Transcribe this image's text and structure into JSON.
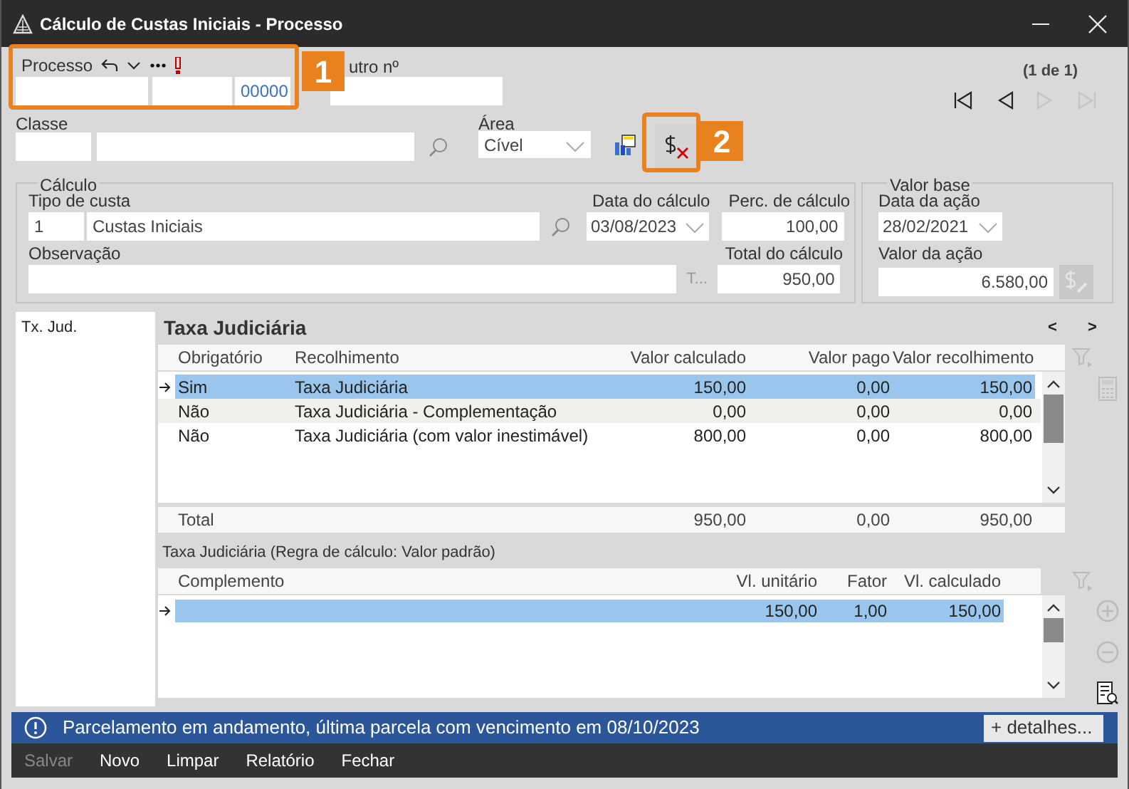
{
  "window": {
    "title": "Cálculo de Custas Iniciais - Processo"
  },
  "processo": {
    "label": "Processo",
    "suffix": "00000"
  },
  "outro_numero": {
    "label": "utro nº"
  },
  "pager": {
    "text": "(1 de 1)",
    "buttons": [
      {
        "disabled": false
      },
      {
        "disabled": false
      },
      {
        "disabled": true
      },
      {
        "disabled": true
      }
    ]
  },
  "classe": {
    "label": "Classe"
  },
  "area": {
    "label": "Área",
    "value": "Cível"
  },
  "callouts": [
    {
      "number": "1"
    },
    {
      "number": "2"
    }
  ],
  "calculo": {
    "title": "Cálculo",
    "tipo_label": "Tipo de custa",
    "tipo_code": "1",
    "tipo_name": "Custas Iniciais",
    "data_label": "Data do cálculo",
    "data": "03/08/2023",
    "perc_label": "Perc. de cálculo",
    "perc": "100,00",
    "obs_label": "Observação",
    "obs_button": "T...",
    "total_label": "Total do cálculo",
    "total": "950,00"
  },
  "valor_base": {
    "title": "Valor base",
    "data_label": "Data da ação",
    "data": "28/02/2021",
    "valor_label": "Valor da ação",
    "valor": "6.580,00",
    "edit_disabled": true
  },
  "sidebar": {
    "items": [
      {
        "label": "Tx. Jud."
      }
    ]
  },
  "taxa": {
    "title": "Taxa Judiciária",
    "prev": "<",
    "next": ">",
    "columns": [
      "Obrigatório",
      "Recolhimento",
      "Valor calculado",
      "Valor pago",
      "Valor recolhimento"
    ],
    "rows": [
      {
        "selected": true,
        "cells": [
          "Sim",
          "Taxa Judiciária",
          "150,00",
          "0,00",
          "150,00"
        ]
      },
      {
        "selected": false,
        "cells": [
          "Não",
          "Taxa Judiciária - Complementação",
          "0,00",
          "0,00",
          "0,00"
        ]
      },
      {
        "selected": false,
        "cells": [
          "Não",
          "Taxa Judiciária (com valor inestimável)",
          "800,00",
          "0,00",
          "800,00"
        ]
      }
    ],
    "total": [
      "Total",
      "950,00",
      "0,00",
      "950,00"
    ]
  },
  "complemento": {
    "title": "Taxa Judiciária (Regra de cálculo: Valor padrão)",
    "columns": [
      "Complemento",
      "Vl. unitário",
      "Fator",
      "Vl. calculado"
    ],
    "rows": [
      {
        "selected": true,
        "values": [
          "150,00",
          "1,00",
          "150,00"
        ]
      }
    ]
  },
  "notification": {
    "message": "Parcelamento em andamento, última parcela com vencimento em 08/10/2023",
    "button": "+ detalhes..."
  },
  "actions": [
    {
      "label": "Salvar",
      "disabled": true
    },
    {
      "label": "Novo",
      "disabled": false
    },
    {
      "label": "Limpar",
      "disabled": false
    },
    {
      "label": "Relatório",
      "disabled": false
    },
    {
      "label": "Fechar",
      "disabled": false
    }
  ]
}
